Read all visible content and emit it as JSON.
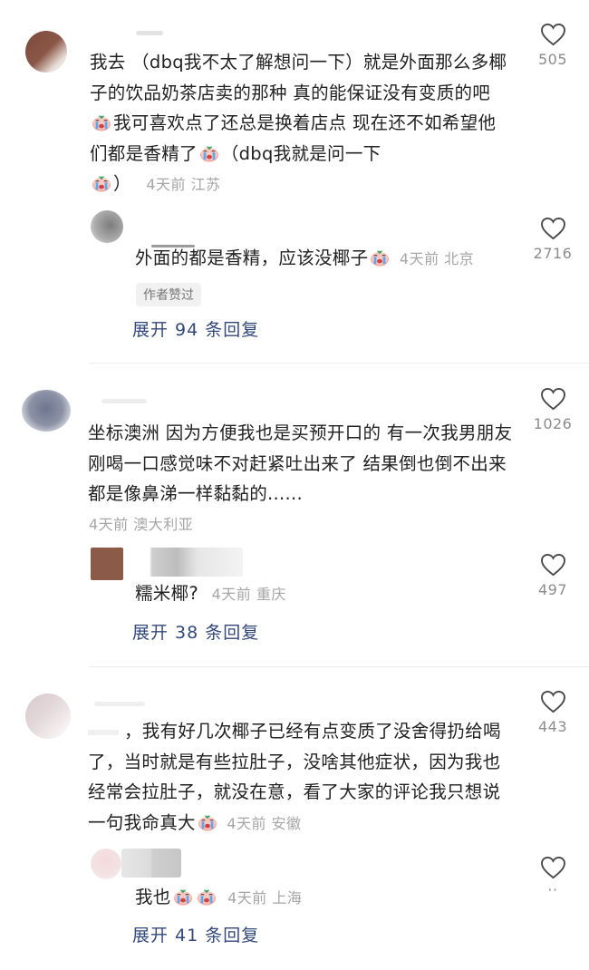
{
  "comments": [
    {
      "text_parts": [
        "我去 （dbq我不太了解想问一下）就是外面那么多椰子的饮品奶茶店卖的那种 真的能保证没有变质的吧",
        "我可喜欢点了还总是换着店点 现在还不如希望他们都是香精了",
        "（dbq我就是问一下",
        "）"
      ],
      "meta": "4天前 江苏",
      "likes": "505",
      "reply": {
        "text": "外面的都是香精，应该没椰子",
        "meta": "4天前 北京",
        "likes": "2716",
        "badge": "作者赞过"
      },
      "expand_label": "展开 94 条回复"
    },
    {
      "text": "坐标澳洲 因为方便我也是买预开口的 有一次我男朋友刚喝一口感觉味不对赶紧吐出来了 结果倒也倒不出来 都是像鼻涕一样黏黏的......",
      "meta": "4天前 澳大利亚",
      "likes": "1026",
      "reply": {
        "text": "糯米椰?",
        "meta": "4天前 重庆",
        "likes": "497"
      },
      "expand_label": "展开 38 条回复"
    },
    {
      "text": "，我有好几次椰子已经有点变质了没舍得扔给喝了，当时就是有些拉肚子，没啥其他症状，因为我也经常会拉肚子，就没在意，看了大家的评论我只想说一句我命真大",
      "meta": "4天前 安徽",
      "likes": "443",
      "reply": {
        "text": "我也",
        "meta": "4天前 上海",
        "likes": "··"
      },
      "expand_label": "展开 41 条回复"
    }
  ],
  "colors": {
    "expand": "#33497a",
    "meta": "#a6a6a6",
    "text": "#222222"
  },
  "icons": {
    "like": "heart-outline-icon",
    "emoji": "crying-face-icon"
  }
}
